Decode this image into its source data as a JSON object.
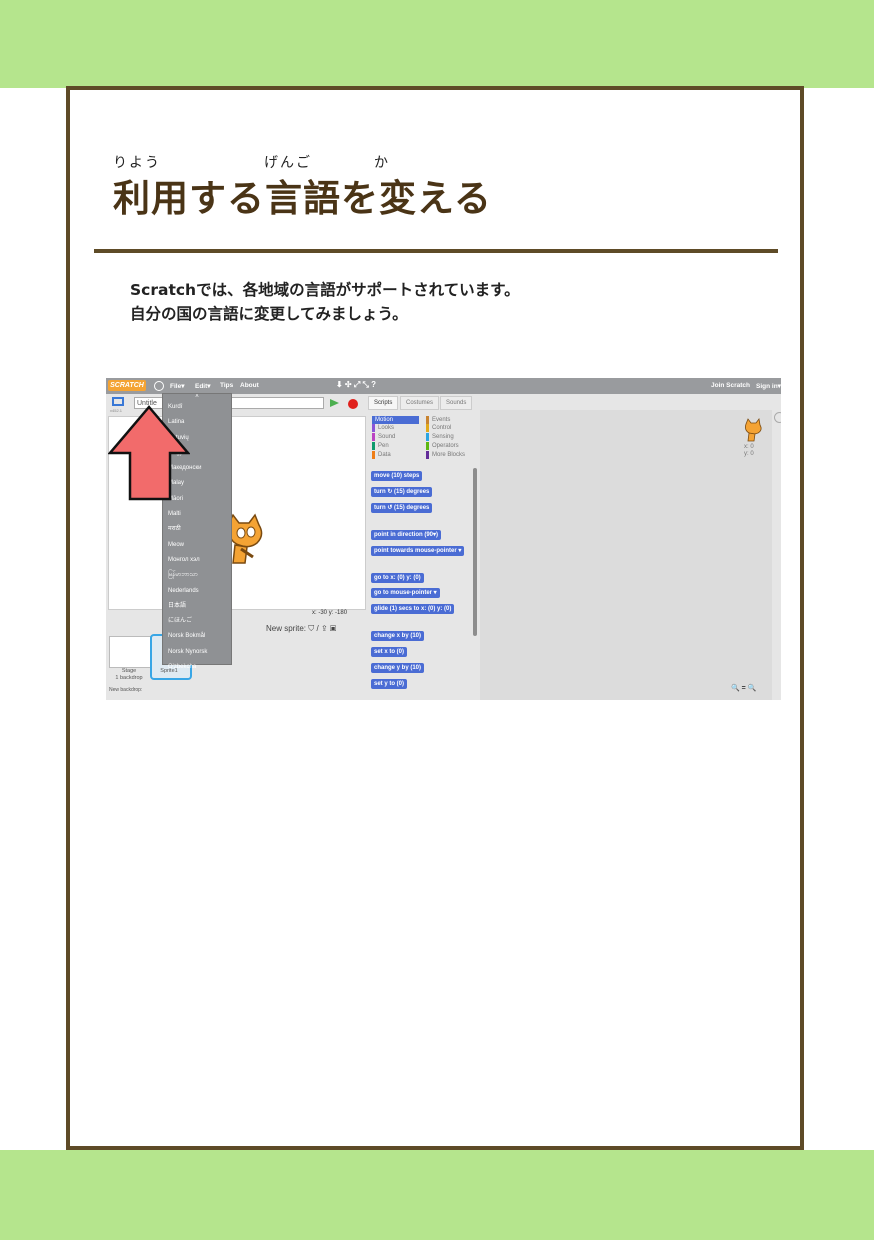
{
  "header": {
    "ruby": {
      "riyou": "りよう",
      "gengo": "げんご",
      "ka": "か"
    },
    "title": "利用する言語を変える"
  },
  "intro": {
    "line1": "Scratchでは、各地域の言語がサポートされています。",
    "line2": "自分の国の言語に変更してみましょう。"
  },
  "screenshot": {
    "menubar": {
      "logo": "SCRATCH",
      "file": "File▾",
      "edit": "Edit▾",
      "tips": "Tips",
      "about": "About",
      "join": "Join Scratch",
      "signin": "Sign in▾"
    },
    "stage": {
      "title_value": "Untitle",
      "version": "v452.1",
      "coords_x": "x: -30",
      "coords_y": "y: -180",
      "new_sprite_label": "New sprite:"
    },
    "language_menu": [
      "Kurdî",
      "Latina",
      "Lietuvių",
      "Magyar",
      "Македонски",
      "Malay",
      "Māori",
      "Malti",
      "मराठी",
      "Meow",
      "Монгол хэл",
      "မြန်မာဘာသာ",
      "Nederlands",
      "日本語",
      "にほんご",
      "Norsk Bokmål",
      "Norsk Nynorsk",
      "O'zbekcha"
    ],
    "sprites": {
      "stage_label": "Stage",
      "stage_sub": "1 backdrop",
      "sprite_label": "Sprite1",
      "new_backdrop": "New backdrop:"
    },
    "tabs": [
      "Scripts",
      "Costumes",
      "Sounds"
    ],
    "categories_left": [
      "Motion",
      "Looks",
      "Sound",
      "Pen",
      "Data"
    ],
    "categories_right": [
      "Events",
      "Control",
      "Sensing",
      "Operators",
      "More Blocks"
    ],
    "category_colors": {
      "Motion": "#4a6cd4",
      "Looks": "#8a55d7",
      "Sound": "#bb42c3",
      "Pen": "#0e9a6c",
      "Data": "#ee7d16",
      "Events": "#c88330",
      "Control": "#e1a91a",
      "Sensing": "#2ca5e2",
      "Operators": "#5cb712",
      "More Blocks": "#632d99"
    },
    "blocks": [
      "move (10) steps",
      "turn ↻ (15) degrees",
      "turn ↺ (15) degrees",
      "point in direction (90▾)",
      "point towards mouse-pointer ▾",
      "go to x: (0) y: (0)",
      "go to mouse-pointer ▾",
      "glide (1) secs to x: (0) y: (0)",
      "change x by (10)",
      "set x to (0)",
      "change y by (10)",
      "set y to (0)"
    ],
    "sprite_xy": {
      "x": "x: 0",
      "y": "y: 0"
    },
    "zoom": "🔍 = 🔍"
  },
  "colors": {
    "band": "#b5e58d",
    "frame": "#5e4b27",
    "title": "#4a3416",
    "arrow": "#f26b6b"
  }
}
